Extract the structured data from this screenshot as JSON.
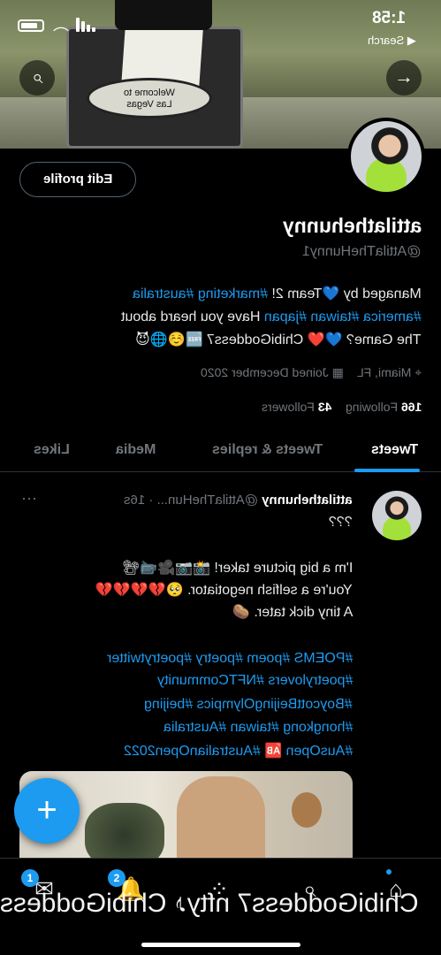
{
  "status_bar": {
    "time": "1:58",
    "back_label": "◀ Search"
  },
  "banner": {
    "sign_line1": "Welcome to",
    "sign_line2": "Las Vegas"
  },
  "header": {
    "search_icon": "🔍",
    "forward_icon": "→",
    "edit_profile_label": "Edit profile"
  },
  "profile": {
    "display_name": "attilathehunny",
    "handle": "@AttilaTheHunny1",
    "bio": {
      "line1_prefix": "Managed by ",
      "line1_heart": "💙",
      "line1_mid": "Team 2! ",
      "line1_tags": "#marketing #australia",
      "line2_tags": "#america #taiwan #japan",
      "line2_text": " Have you heard about",
      "line3_text": "The Game? 💙❤️ ChibiGoddess7 🆓☺️🌐😈"
    },
    "location": "Miami, FL",
    "joined": "Joined December 2020",
    "following_count": "166",
    "following_label": "Following",
    "followers_count": "43",
    "followers_label": "Followers"
  },
  "tabs": [
    {
      "label": "Tweets",
      "active": true
    },
    {
      "label": "Tweets & replies",
      "active": false
    },
    {
      "label": "Media",
      "active": false
    },
    {
      "label": "Likes",
      "active": false
    }
  ],
  "tweet": {
    "author": "attilathehunny",
    "handle": "@AttilaTheHun...",
    "time": "· 16s",
    "more": "···",
    "lines": [
      "???",
      "I'm a big picture taker! 📸📷🎥📹📽",
      "You're a selfish negotiator. 🥺💔💔💔💔",
      "A tiny dick tater. 🥔"
    ],
    "hashtags": [
      "#POEMS #poem #poetry #poetrytwitter",
      "#poetrylovers #NFTCommunity",
      "#BoycottBeijingOlympics #beijing",
      "#hongkong #taiwan #Australia",
      "#AusOpen 🆎 #AustralianOpen2022"
    ]
  },
  "fab_label": "+",
  "bottom_nav": {
    "messages_badge": "1",
    "notifications_badge": "2",
    "ticker": "ChibiGoddess7 nfty♪ ChibiGoddess"
  }
}
